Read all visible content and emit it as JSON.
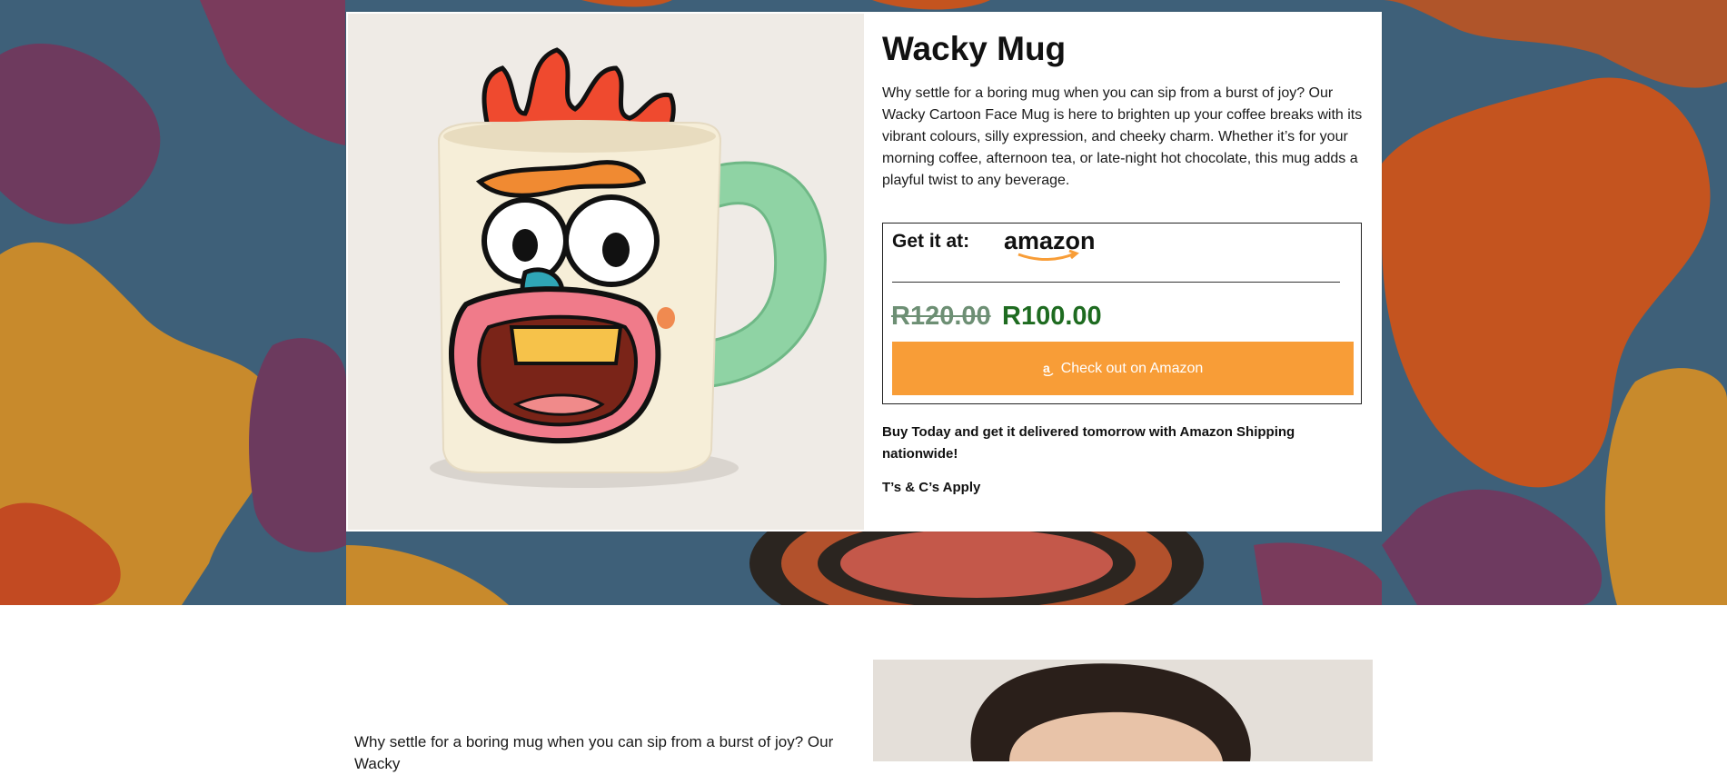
{
  "product": {
    "title": "Wacky Mug",
    "description": "Why settle for a boring mug when you can sip from a burst of joy? Our Wacky Cartoon Face Mug is here to brighten up your coffee breaks with its vibrant colours, silly expression, and cheeky charm. Whether it’s for your morning coffee, afternoon tea, or late-night hot chocolate, this mug adds a playful twist to any beverage."
  },
  "buybox": {
    "get_it_label": "Get it at:",
    "store_logo_text": "amazon",
    "old_price": "R120.00",
    "new_price": "R100.00",
    "checkout_label": "Check out on Amazon"
  },
  "shipping_note": "Buy Today and get it delivered tomorrow with Amazon Shipping nationwide!",
  "terms": "T’s & C’s Apply",
  "section2": {
    "text": "Why settle for a boring mug when you can sip from a burst of joy? Our Wacky"
  },
  "colors": {
    "checkout_button": "#f89d37",
    "new_price": "#1e6b20",
    "old_price": "#6d8f74"
  },
  "icons": {
    "amazon_small": "amazon-a-icon"
  }
}
